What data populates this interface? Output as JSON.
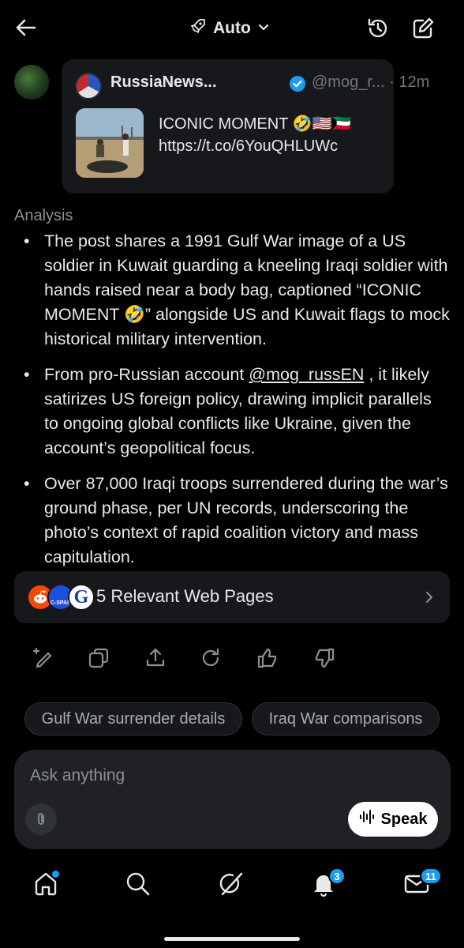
{
  "header": {
    "mode_label": "Auto",
    "icons": [
      "back-arrow-icon",
      "rocket-icon",
      "chevron-down-icon",
      "history-icon",
      "compose-icon"
    ]
  },
  "quoted_post": {
    "author_name": "RussiaNews...",
    "handle_time": "@mog_r... · 12m",
    "text_line1": "ICONIC MOMENT 🤣🇺🇸🇰🇼",
    "text_line2": "https://t.co/6YouQHLUWc"
  },
  "analysis": {
    "label": "Analysis",
    "bullets": [
      {
        "text": "The post shares a 1991 Gulf War image of a US soldier in Kuwait guarding a kneeling Iraqi soldier with hands raised near a body bag, captioned “ICONIC MOMENT 🤣” alongside US and Kuwait flags to mock historical military intervention."
      },
      {
        "prefix": "From pro-Russian account ",
        "mention": "@mog_russEN",
        "suffix": " , it likely satirizes US foreign policy, drawing implicit parallels to ongoing global conflicts like Ukraine, given the account’s geopolitical focus."
      },
      {
        "text": "Over 87,000 Iraqi troops surrendered during the war’s ground phase, per UN records, underscoring the photo’s context of rapid coalition victory and mass capitulation."
      }
    ]
  },
  "web_pages": {
    "label": "5 Relevant Web Pages",
    "source_icons": [
      "reddit-icon",
      "cspan-icon",
      "google-icon"
    ],
    "cspan_text": "C-SPAN",
    "google_text": "G"
  },
  "actions": [
    "regenerate-edit-icon",
    "copy-icon",
    "share-icon",
    "refresh-icon",
    "thumbs-up-icon",
    "thumbs-down-icon"
  ],
  "suggestions": [
    "Gulf War surrender details",
    "Iraq War comparisons"
  ],
  "composer": {
    "placeholder": "Ask anything",
    "speak_label": "Speak"
  },
  "bottom_nav": {
    "items": [
      "home-icon",
      "search-icon",
      "grok-icon",
      "notifications-icon",
      "messages-icon"
    ],
    "notifications_count": "3",
    "messages_count": "11"
  },
  "colors": {
    "background": "#000000",
    "card": "#16181c",
    "accent_blue": "#1d9bf0",
    "muted_text": "#71767b"
  }
}
